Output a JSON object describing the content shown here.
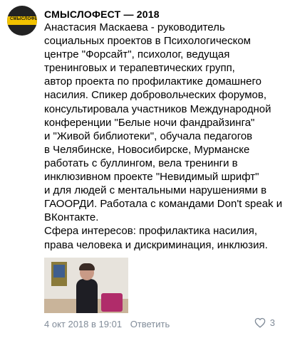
{
  "post": {
    "author": "СМЫСЛОФЕСТ — 2018",
    "avatar_text": "СМЫСЛОФЕСТ",
    "paragraphs": [
      "Анастасия Маскаева - руководитель\nсоциальных проектов в Психологическом\nцентре \"Форсайт\", психолог, ведущая\nтренинговых и терапевтических групп,\nавтор проекта по профилактике домашнего\nнасилия. Спикер добровольческих форумов,\nконсультировала участников Международной\nконференции \"Белые ночи фандрайзинга\"\nи \"Живой библиотеки\", обучала педагогов\nв Челябинске, Новосибирске, Мурманске\nработать с буллингом, вела тренинги в\nинклюзивном проекте \"Невидимый шрифт\"\nи для людей с ментальными нарушениями в\nГАООРДИ. Работала с командами Don't speak и\nВКонтакте.",
      "Сфера интересов: профилактика насилия,\nправа человека и дискриминация, инклюзия."
    ],
    "date": "4 окт 2018 в 19:01",
    "reply_label": "Ответить",
    "likes_count": "3",
    "icons": {
      "like": "heart-outline-icon"
    },
    "colors": {
      "meta": "#818c99",
      "avatar_stripe": "#f2c200"
    }
  }
}
